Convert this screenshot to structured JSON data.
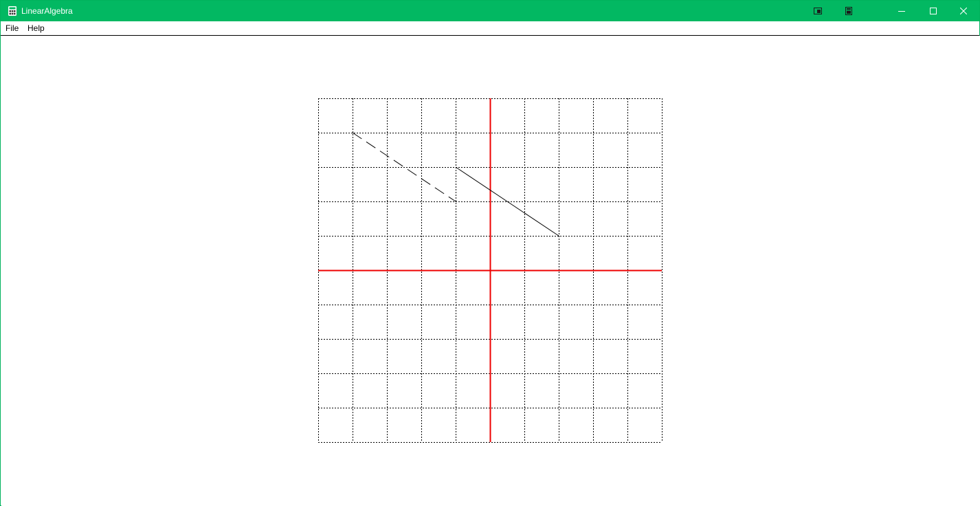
{
  "window": {
    "title": "LinearAlgebra",
    "accent_color": "#02b862",
    "app_icon": "calculator-icon"
  },
  "titlebar_buttons": [
    {
      "name": "extra-button-1",
      "icon": "window-snap-icon"
    },
    {
      "name": "extra-button-2",
      "icon": "calculator-small-icon"
    },
    {
      "name": "minimize-button",
      "icon": "minimize-icon"
    },
    {
      "name": "maximize-button",
      "icon": "maximize-icon"
    },
    {
      "name": "close-button",
      "icon": "close-icon"
    }
  ],
  "menu": {
    "items": [
      {
        "label": "File"
      },
      {
        "label": "Help"
      }
    ]
  },
  "plot": {
    "grid_range": [
      -5,
      5
    ],
    "grid_step": 1,
    "grid_style": "dashed",
    "axis_color": "#ee0000",
    "vectors": [
      {
        "from": [
          -4,
          4
        ],
        "to": [
          -1,
          2
        ],
        "style": "dashed"
      },
      {
        "from": [
          -1,
          3
        ],
        "to": [
          2,
          1
        ],
        "style": "solid"
      }
    ]
  }
}
